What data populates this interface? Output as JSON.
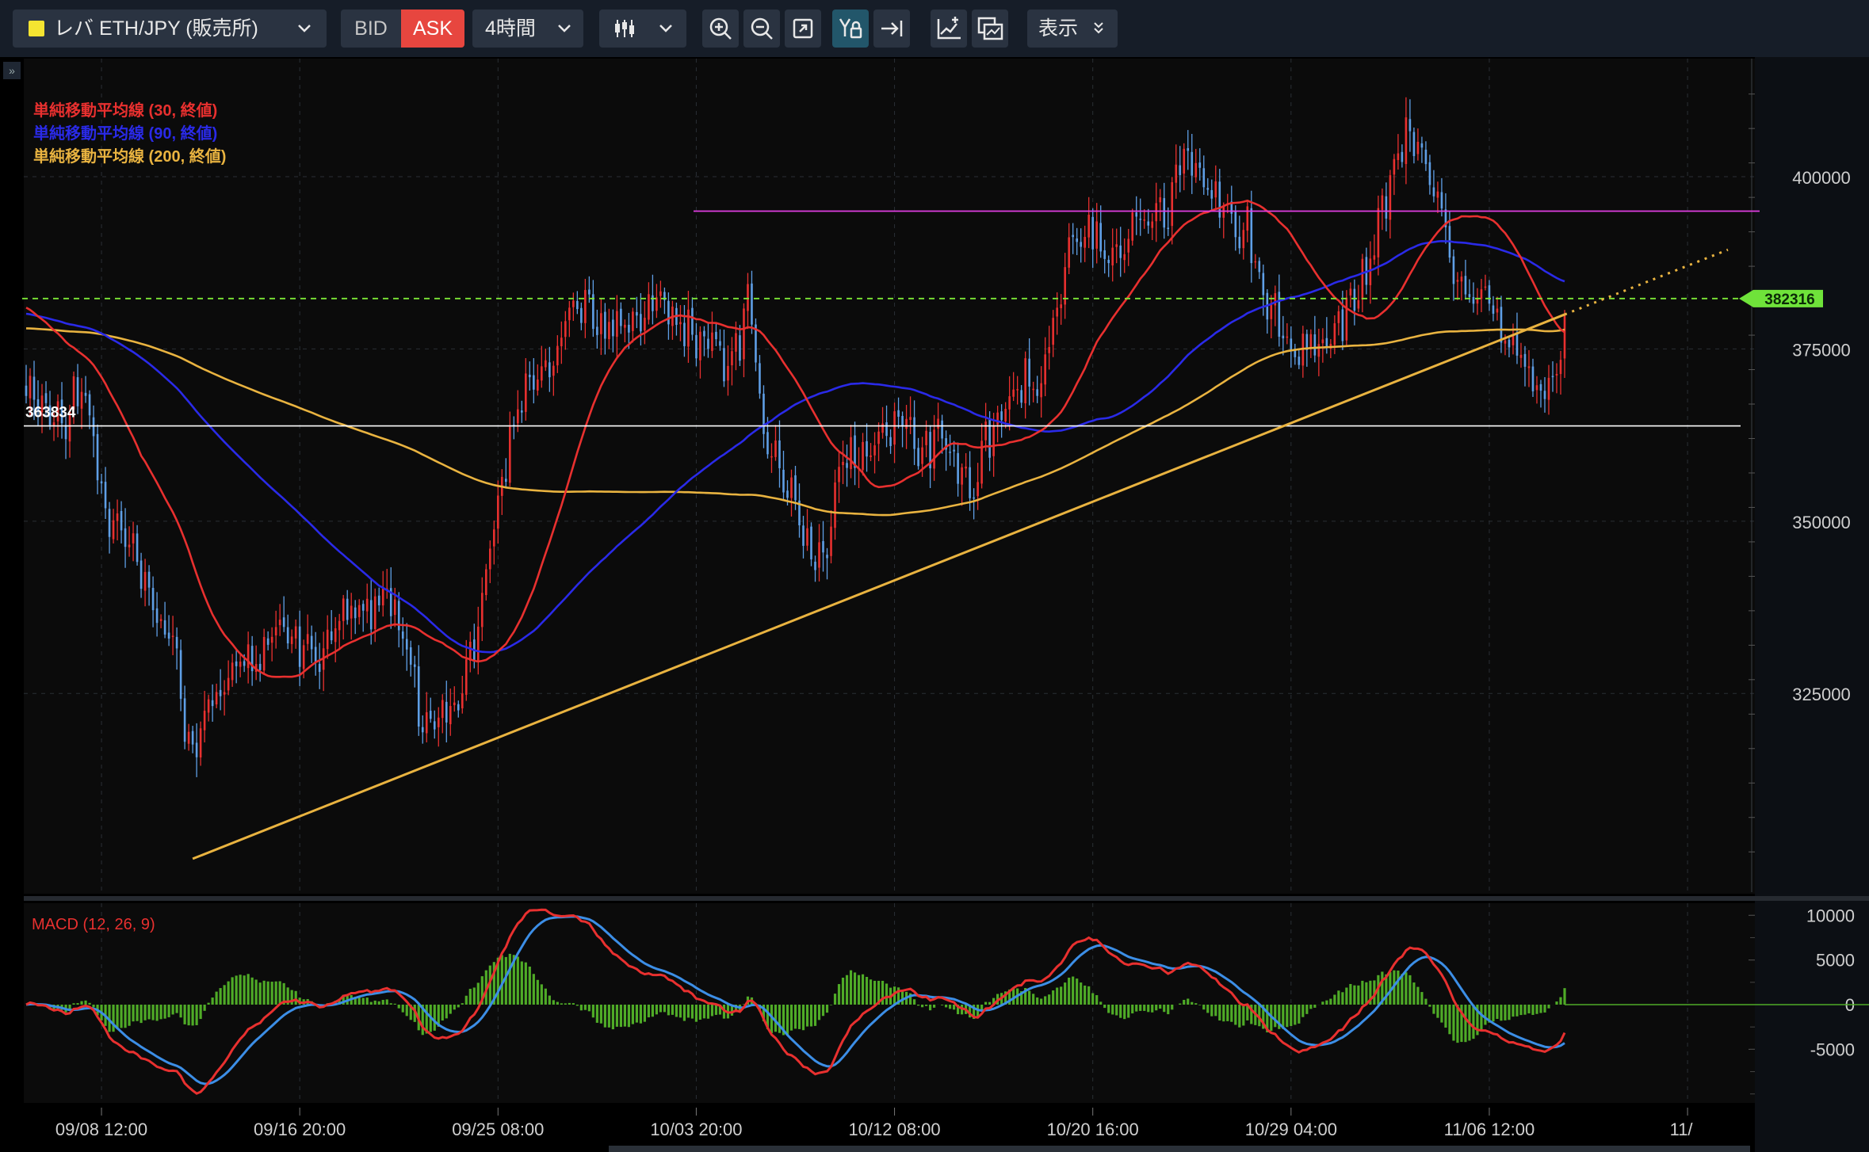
{
  "toolbar": {
    "symbol": "レバ ETH/JPY (販売所)",
    "symbol_color": "#f5e431",
    "bid_label": "BID",
    "ask_label": "ASK",
    "timeframe": "4時間",
    "display_label": "表示",
    "icons": [
      "chevron-down-icon",
      "candlestick-icon",
      "zoom-in-icon",
      "zoom-out-icon",
      "fit-screen-icon",
      "auto-scale-icon",
      "scroll-to-latest-icon",
      "add-indicator-icon",
      "compare-icon"
    ]
  },
  "chart_data": {
    "type": "candlestick",
    "x_tick_labels": [
      "09/08 12:00",
      "09/16 20:00",
      "09/25 08:00",
      "10/03 20:00",
      "10/12 08:00",
      "10/20 16:00",
      "10/29 04:00",
      "11/06 12:00",
      "11/"
    ],
    "y_tick_labels": [
      "325000",
      "350000",
      "375000",
      "400000"
    ],
    "ylim": [
      298000,
      413000
    ],
    "current_price": 382316,
    "marked_price": 363834,
    "resistance_price": 395000,
    "colors": {
      "up": "#e8302f",
      "down": "#5f9fe6",
      "sma30": "#e8302f",
      "sma90": "#2a2ae8",
      "sma200": "#e9b340",
      "trendline": "#e9b340",
      "resistance": "#e23ee3",
      "current": "#7de836",
      "marked": "#ffffff"
    },
    "legend": [
      {
        "label": "単純移動平均線 (30, 終値)",
        "color": "#e8302f"
      },
      {
        "label": "単純移動平均線 (90, 終値)",
        "color": "#2a2ae8"
      },
      {
        "label": "単純移動平均線 (200, 終値)",
        "color": "#e9b340"
      }
    ],
    "close_anchors": [
      [
        0,
        368000
      ],
      [
        10,
        365000
      ],
      [
        14,
        370000
      ],
      [
        20,
        352000
      ],
      [
        28,
        344000
      ],
      [
        36,
        334000
      ],
      [
        42,
        315000
      ],
      [
        46,
        323000
      ],
      [
        52,
        327000
      ],
      [
        58,
        330000
      ],
      [
        62,
        335000
      ],
      [
        68,
        333000
      ],
      [
        74,
        330000
      ],
      [
        80,
        338000
      ],
      [
        86,
        336000
      ],
      [
        90,
        340000
      ],
      [
        96,
        332000
      ],
      [
        100,
        321000
      ],
      [
        108,
        323000
      ],
      [
        114,
        334000
      ],
      [
        120,
        356000
      ],
      [
        124,
        368000
      ],
      [
        130,
        371000
      ],
      [
        136,
        378000
      ],
      [
        142,
        381000
      ],
      [
        148,
        377000
      ],
      [
        154,
        379000
      ],
      [
        160,
        382000
      ],
      [
        166,
        378000
      ],
      [
        172,
        377000
      ],
      [
        178,
        372000
      ],
      [
        182,
        381000
      ],
      [
        186,
        363000
      ],
      [
        190,
        357000
      ],
      [
        194,
        352000
      ],
      [
        198,
        344000
      ],
      [
        202,
        347000
      ],
      [
        206,
        360000
      ],
      [
        210,
        358000
      ],
      [
        214,
        362000
      ],
      [
        218,
        362000
      ],
      [
        222,
        366000
      ],
      [
        226,
        360000
      ],
      [
        230,
        362000
      ],
      [
        234,
        358000
      ],
      [
        238,
        355000
      ],
      [
        242,
        362000
      ],
      [
        246,
        366000
      ],
      [
        250,
        370000
      ],
      [
        256,
        370000
      ],
      [
        260,
        381000
      ],
      [
        264,
        390000
      ],
      [
        268,
        392000
      ],
      [
        272,
        390000
      ],
      [
        278,
        392000
      ],
      [
        282,
        395000
      ],
      [
        288,
        395000
      ],
      [
        292,
        404000
      ],
      [
        296,
        401000
      ],
      [
        302,
        395000
      ],
      [
        308,
        392000
      ],
      [
        312,
        383000
      ],
      [
        316,
        378000
      ],
      [
        320,
        374000
      ],
      [
        326,
        377000
      ],
      [
        330,
        378000
      ],
      [
        336,
        383000
      ],
      [
        340,
        390000
      ],
      [
        344,
        400000
      ],
      [
        348,
        407000
      ],
      [
        352,
        403000
      ],
      [
        356,
        398000
      ],
      [
        360,
        386000
      ],
      [
        364,
        381000
      ],
      [
        368,
        383000
      ],
      [
        372,
        377000
      ],
      [
        376,
        375000
      ],
      [
        380,
        370000
      ],
      [
        384,
        369000
      ],
      [
        386,
        372000
      ],
      [
        388,
        380000
      ]
    ],
    "macd_ylim": [
      -11000,
      11000
    ],
    "macd_tick_labels": [
      "10000",
      "5000",
      "0",
      "-5000"
    ],
    "macd_legend": "MACD (12, 26, 9)",
    "macd_colors": {
      "macd": "#e8302f",
      "signal": "#3c8ee6",
      "hist": "#4fab27"
    }
  }
}
